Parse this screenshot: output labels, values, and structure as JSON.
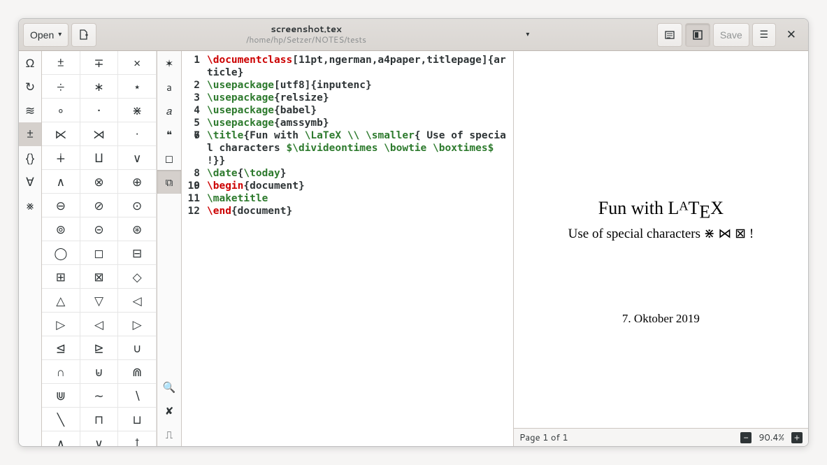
{
  "header": {
    "open_label": "Open",
    "title": "screenshot.tex",
    "subtitle": "/home/hp/Setzer/NOTES/tests",
    "save_label": "Save"
  },
  "symbol_categories": [
    "Ω",
    "↻",
    "≋",
    "±",
    "{}",
    "∀",
    "⨳"
  ],
  "symbol_categories_selected": 3,
  "symbols": [
    "±",
    "∓",
    "×",
    "÷",
    "∗",
    "⋆",
    "∘",
    "•",
    "⋇",
    "⋉",
    "⋊",
    "·",
    "∔",
    "⨿",
    "∨",
    "∧",
    "⊗",
    "⊕",
    "⊖",
    "⊘",
    "⊙",
    "⊚",
    "⊝",
    "⊛",
    "◯",
    "◻",
    "⊟",
    "⊞",
    "⊠",
    "◇",
    "△",
    "▽",
    "◁",
    "▷",
    "◁",
    "▷",
    "⊴",
    "⊵",
    "∪",
    "∩",
    "⊌",
    "⋒",
    "⋓",
    "∼",
    "∖",
    "╲",
    "⊓",
    "⊔",
    "∧",
    "∨",
    "†"
  ],
  "toolstrip": [
    "✶",
    "a",
    "𝑎",
    "❝",
    "◻",
    "⧉"
  ],
  "toolstrip_selected": 5,
  "toolstrip_bottom": [
    "🔍",
    "✘",
    "⎍"
  ],
  "code_lines": [
    {
      "n": 1,
      "segs": [
        [
          "cmd-red",
          "\\documentclass"
        ],
        [
          "opt",
          "[11pt,ngerman,a4paper,titlepage]"
        ],
        [
          "",
          "{article}"
        ]
      ]
    },
    {
      "n": 2,
      "segs": [
        [
          "cmd-green",
          "\\usepackage"
        ],
        [
          "opt",
          "[utf8]"
        ],
        [
          "",
          "{inputenc}"
        ]
      ]
    },
    {
      "n": 3,
      "segs": [
        [
          "cmd-green",
          "\\usepackage"
        ],
        [
          "",
          "{relsize}"
        ]
      ]
    },
    {
      "n": 4,
      "segs": [
        [
          "cmd-green",
          "\\usepackage"
        ],
        [
          "",
          "{babel}"
        ]
      ]
    },
    {
      "n": 5,
      "segs": [
        [
          "cmd-green",
          "\\usepackage"
        ],
        [
          "",
          "{amssymb}"
        ]
      ]
    },
    {
      "n": 6,
      "segs": [
        [
          "",
          ""
        ]
      ]
    },
    {
      "n": 7,
      "segs": [
        [
          "cmd-green",
          "\\title"
        ],
        [
          "",
          "{Fun with "
        ],
        [
          "cmd-green",
          "\\LaTeX "
        ],
        [
          "cmd-green",
          "\\\\ "
        ],
        [
          "cmd-green",
          "\\smaller"
        ],
        [
          "",
          "{ Use of special characters "
        ],
        [
          "math",
          "$"
        ],
        [
          "cmd-green",
          "\\divideontimes \\bowtie \\boxtimes"
        ],
        [
          "math",
          "$"
        ],
        [
          "",
          " !}}"
        ]
      ]
    },
    {
      "n": 8,
      "segs": [
        [
          "cmd-green",
          "\\date"
        ],
        [
          "",
          "{"
        ],
        [
          "cmd-green",
          "\\today"
        ],
        [
          "",
          "}"
        ]
      ]
    },
    {
      "n": 9,
      "segs": [
        [
          "",
          ""
        ]
      ]
    },
    {
      "n": 10,
      "segs": [
        [
          "cmd-red",
          "\\begin"
        ],
        [
          "",
          "{document}"
        ]
      ]
    },
    {
      "n": 11,
      "segs": [
        [
          "cmd-green",
          "\\maketitle"
        ]
      ]
    },
    {
      "n": 12,
      "segs": [
        [
          "cmd-red",
          "\\end"
        ],
        [
          "",
          "{document}"
        ]
      ]
    }
  ],
  "preview": {
    "title_pre": "Fun with L",
    "title_a": "A",
    "title_post": "T",
    "title_e": "E",
    "title_x": "X",
    "subtitle": "Use of special characters ⋇ ⋈ ⊠ !",
    "date": "7. Oktober 2019"
  },
  "status": {
    "page": "Page 1 of 1",
    "zoom": "90.4%"
  }
}
